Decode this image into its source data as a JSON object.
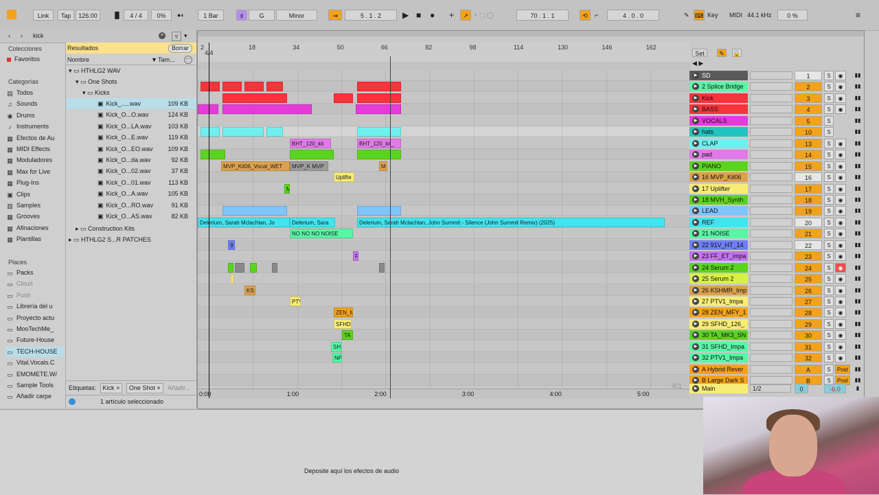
{
  "topbar": {
    "link": "Link",
    "tap": "Tap",
    "tempo": "126.00",
    "signature": "4 / 4",
    "cpu": "0%",
    "quantize": "1 Bar",
    "key": "G",
    "scale": "Minor",
    "position": "5 .  1 .  2",
    "loop_start": "70 .  1 .  1",
    "loop_length": "4 .  0 .  0",
    "key_label": "Key",
    "midi_label": "MIDI",
    "sample_rate": "44.1 kHz",
    "cpu_load": "0 %"
  },
  "browser": {
    "search_value": "kick",
    "colecciones_label": "Colecciones",
    "favoritos": "Favoritos",
    "results_label": "Resultados",
    "clear_button": "Borrar",
    "categorias_label": "Categorías",
    "categories": [
      "Todos",
      "Sounds",
      "Drums",
      "Instruments",
      "Efectos de Au",
      "MIDI Effects",
      "Moduladores",
      "Max for Live",
      "Plug-Ins",
      "Clips",
      "Samples",
      "Grooves",
      "Afinaciones",
      "Plantillas"
    ],
    "places_label": "Places",
    "places": [
      "Packs",
      "Cloud",
      "Push",
      "Librería del u",
      "Proyecto actu",
      "MooTechMe_",
      "Future-House",
      "TECH-HOUSE",
      "Vital.Vocals.C",
      "EMOMETE.W/",
      "Sample Tools",
      "Añadir carpe"
    ],
    "col_name": "Nombre",
    "col_size": "Tam...",
    "tree": {
      "root": "HTHLG2 WAV",
      "one_shots": "One Shots",
      "kicks": "Kicks",
      "construction_kits": "Construction Kits",
      "patches": "HTHLG2 S...R PATCHES"
    },
    "files": [
      {
        "name": "Kick_.....wav",
        "size": "109 KB"
      },
      {
        "name": "Kick_O...O.wav",
        "size": "124 KB"
      },
      {
        "name": "Kick_O...LA.wav",
        "size": "103 KB"
      },
      {
        "name": "Kick_O...E.wav",
        "size": "119 KB"
      },
      {
        "name": "Kick_O...EO.wav",
        "size": "109 KB"
      },
      {
        "name": "Kick_O...da.wav",
        "size": "92 KB"
      },
      {
        "name": "Kick_O...02.wav",
        "size": "37 KB"
      },
      {
        "name": "Kick_O...01.wav",
        "size": "113 KB"
      },
      {
        "name": "Kick_O...A.wav",
        "size": "105 KB"
      },
      {
        "name": "Kick_O...RO.wav",
        "size": "91 KB"
      },
      {
        "name": "Kick_O...AS.wav",
        "size": "82 KB"
      }
    ],
    "tags_label": "Etiquetas:",
    "tag1": "Kick",
    "tag2": "One Shot",
    "add_tag": "Añadir...",
    "status": "1 artículo seleccionado"
  },
  "arrangement": {
    "start_marker": "4/4",
    "bars": [
      "2",
      "18",
      "34",
      "50",
      "66",
      "82",
      "98",
      "114",
      "130",
      "146",
      "162"
    ],
    "times": [
      "0:00",
      "1:00",
      "2:00",
      "3:00",
      "4:00",
      "5:00"
    ],
    "zoom_label": "4/1",
    "set_label": "Set"
  },
  "clips": [
    {
      "lane": 1,
      "label": "",
      "color": "#f7333c",
      "start": 4,
      "width": 28
    },
    {
      "lane": 1,
      "label": "",
      "color": "#f7333c",
      "start": 36,
      "width": 28
    },
    {
      "lane": 1,
      "label": "",
      "color": "#f7333c",
      "start": 68,
      "width": 28
    },
    {
      "lane": 1,
      "label": "",
      "color": "#f7333c",
      "start": 100,
      "width": 24
    },
    {
      "lane": 1,
      "label": "",
      "color": "#f7333c",
      "start": 232,
      "width": 64
    },
    {
      "lane": 2,
      "label": "",
      "color": "#f7333c",
      "start": 36,
      "width": 94
    },
    {
      "lane": 2,
      "label": "",
      "color": "#f7333c",
      "start": 198,
      "width": 28
    },
    {
      "lane": 2,
      "label": "",
      "color": "#f7333c",
      "start": 232,
      "width": 64
    },
    {
      "lane": 3,
      "label": "",
      "color": "#e53bd9",
      "start": 0,
      "width": 30
    },
    {
      "lane": 3,
      "label": "",
      "color": "#e53bd9",
      "start": 36,
      "width": 130
    },
    {
      "lane": 3,
      "label": "",
      "color": "#e53bd9",
      "start": 230,
      "width": 66
    },
    {
      "lane": 5,
      "label": "",
      "color": "#6ff0ee",
      "start": 4,
      "width": 28
    },
    {
      "lane": 5,
      "label": "",
      "color": "#6ff0ee",
      "start": 36,
      "width": 60
    },
    {
      "lane": 5,
      "label": "",
      "color": "#6ff0ee",
      "start": 100,
      "width": 24
    },
    {
      "lane": 5,
      "label": "",
      "color": "#6ff0ee",
      "start": 232,
      "width": 64
    },
    {
      "lane": 6,
      "label": "BHT_120_kit",
      "color": "#e17ae8",
      "start": 134,
      "width": 60
    },
    {
      "lane": 6,
      "label": "BHT_120_kit_",
      "color": "#e17ae8",
      "start": 232,
      "width": 64
    },
    {
      "lane": 7,
      "label": "",
      "color": "#5bd41f",
      "start": 4,
      "width": 36
    },
    {
      "lane": 7,
      "label": "",
      "color": "#5bd41f",
      "start": 134,
      "width": 64
    },
    {
      "lane": 7,
      "label": "",
      "color": "#5bd41f",
      "start": 232,
      "width": 64
    },
    {
      "lane": 8,
      "label": "MVP_Kit06_Vocal_WET",
      "color": "#dca14c",
      "start": 34,
      "width": 100
    },
    {
      "lane": 8,
      "label": "MVP_K MVP",
      "color": "#9c9c9c",
      "start": 134,
      "width": 56
    },
    {
      "lane": 8,
      "label": "M",
      "color": "#dca14c",
      "start": 264,
      "width": 12
    },
    {
      "lane": 9,
      "label": "Uplifte",
      "color": "#f7ec76",
      "start": 198,
      "width": 30
    },
    {
      "lane": 10,
      "label": "M",
      "color": "#5bd41f",
      "start": 126,
      "width": 8
    },
    {
      "lane": 12,
      "label": "",
      "color": "#80c4ff",
      "start": 36,
      "width": 94
    },
    {
      "lane": 12,
      "label": "",
      "color": "#80c4ff",
      "start": 232,
      "width": 64
    },
    {
      "lane": 13,
      "label": "Delerium, Sarah Mclachlan, Jo",
      "color": "#3fe5f0",
      "start": 0,
      "width": 134
    },
    {
      "lane": 13,
      "label": "Delerium, Sara",
      "color": "#3fe5f0",
      "start": 134,
      "width": 66
    },
    {
      "lane": 13,
      "label": "Delerium, Sarah Mclachlan, John Summit - Silence (John Summit Remix) (2025)",
      "color": "#3fe5f0",
      "start": 232,
      "width": 448
    },
    {
      "lane": 14,
      "label": "NO NO NO NOISE",
      "color": "#5af5a6",
      "start": 134,
      "width": 92
    },
    {
      "lane": 15,
      "label": "9",
      "color": "#6f7ef5",
      "start": 44,
      "width": 10
    },
    {
      "lane": 16,
      "label": "F",
      "color": "#c373ec",
      "start": 226,
      "width": 8
    },
    {
      "lane": 17,
      "label": "",
      "color": "#5bd41f",
      "start": 44,
      "width": 8
    },
    {
      "lane": 17,
      "label": "",
      "color": "#8a8a8a",
      "start": 54,
      "width": 14
    },
    {
      "lane": 17,
      "label": "",
      "color": "#5bd41f",
      "start": 76,
      "width": 10
    },
    {
      "lane": 17,
      "label": "",
      "color": "#8a8a8a",
      "start": 108,
      "width": 8
    },
    {
      "lane": 17,
      "label": "",
      "color": "#8a8a8a",
      "start": 264,
      "width": 8
    },
    {
      "lane": 18,
      "label": "",
      "color": "#f7ec76",
      "start": 48,
      "width": 4
    },
    {
      "lane": 19,
      "label": "KS",
      "color": "#dca14c",
      "start": 68,
      "width": 16
    },
    {
      "lane": 20,
      "label": "PTV",
      "color": "#f7ec76",
      "start": 134,
      "width": 16
    },
    {
      "lane": 21,
      "label": "ZEN_M",
      "color": "#f2a21b",
      "start": 198,
      "width": 28
    },
    {
      "lane": 22,
      "label": "SFHD",
      "color": "#f7ec76",
      "start": 198,
      "width": 26
    },
    {
      "lane": 23,
      "label": "TA",
      "color": "#5bd41f",
      "start": 210,
      "width": 16
    },
    {
      "lane": 24,
      "label": "SH",
      "color": "#5af5a6",
      "start": 194,
      "width": 16
    },
    {
      "lane": 25,
      "label": "NP",
      "color": "#5af5a6",
      "start": 196,
      "width": 14
    }
  ],
  "tracks": [
    {
      "name": "SD",
      "color": "#5a5a5a",
      "text": "#ffffff",
      "num": "1",
      "yellow": false,
      "rec": "rec"
    },
    {
      "name": "2 Splice Bridge",
      "color": "#5af5a6",
      "text": "#111111",
      "num": "2",
      "yellow": true,
      "rec": "rec"
    },
    {
      "name": "Kick",
      "color": "#f7333c",
      "text": "#111111",
      "num": "3",
      "yellow": true,
      "rec": "rec"
    },
    {
      "name": "BASS",
      "color": "#f7333c",
      "text": "#111111",
      "num": "4",
      "yellow": true,
      "rec": "rec"
    },
    {
      "name": "VOCALS",
      "color": "#e53bd9",
      "text": "#111111",
      "num": "5",
      "yellow": true,
      "rec": ""
    },
    {
      "name": "hats",
      "color": "#21c4c0",
      "text": "#111111",
      "num": "10",
      "yellow": true,
      "rec": ""
    },
    {
      "name": "CLAP",
      "color": "#6ff0ee",
      "text": "#111111",
      "num": "13",
      "yellow": true,
      "rec": "rec"
    },
    {
      "name": "pad",
      "color": "#e17ae8",
      "text": "#111111",
      "num": "14",
      "yellow": true,
      "rec": "rec"
    },
    {
      "name": "PIANO",
      "color": "#5bd41f",
      "text": "#111111",
      "num": "15",
      "yellow": true,
      "rec": "rec"
    },
    {
      "name": "16 MVP_Kit06",
      "color": "#dca14c",
      "text": "#111111",
      "num": "16",
      "yellow": false,
      "rec": "rec"
    },
    {
      "name": "17 Uplifter",
      "color": "#f7ec76",
      "text": "#111111",
      "num": "17",
      "yellow": true,
      "rec": "rec"
    },
    {
      "name": "18 MVH_Synth",
      "color": "#5bd41f",
      "text": "#111111",
      "num": "18",
      "yellow": true,
      "rec": "rec"
    },
    {
      "name": "LEAD",
      "color": "#80c4ff",
      "text": "#111111",
      "num": "19",
      "yellow": true,
      "rec": "rec"
    },
    {
      "name": "REF",
      "color": "#3fe5f0",
      "text": "#111111",
      "num": "20",
      "yellow": false,
      "rec": "rec"
    },
    {
      "name": "21 NOISE",
      "color": "#5af5a6",
      "text": "#111111",
      "num": "21",
      "yellow": true,
      "rec": "rec"
    },
    {
      "name": "22 91V_HT_14",
      "color": "#6f7ef5",
      "text": "#111111",
      "num": "22",
      "yellow": false,
      "rec": "rec"
    },
    {
      "name": "23 FF_ET_impa",
      "color": "#c373ec",
      "text": "#111111",
      "num": "23",
      "yellow": true,
      "rec": "rec"
    },
    {
      "name": "24 Serum 2",
      "color": "#5bd41f",
      "text": "#111111",
      "num": "24",
      "yellow": true,
      "rec": "red"
    },
    {
      "name": "25 Serum 2",
      "color": "#d7f04a",
      "text": "#111111",
      "num": "25",
      "yellow": true,
      "rec": "rec"
    },
    {
      "name": "26 KSHMR_Imp",
      "color": "#dca14c",
      "text": "#111111",
      "num": "26",
      "yellow": true,
      "rec": "rec"
    },
    {
      "name": "27 PTV1_Impa",
      "color": "#f7ec76",
      "text": "#111111",
      "num": "27",
      "yellow": true,
      "rec": "rec"
    },
    {
      "name": "28 ZEN_MFY_1",
      "color": "#f2a21b",
      "text": "#111111",
      "num": "28",
      "yellow": true,
      "rec": "rec"
    },
    {
      "name": "29 SFHD_126_",
      "color": "#f7ec76",
      "text": "#111111",
      "num": "29",
      "yellow": true,
      "rec": "rec"
    },
    {
      "name": "30 TA_MK3_SN",
      "color": "#5bd41f",
      "text": "#111111",
      "num": "30",
      "yellow": true,
      "rec": "rec"
    },
    {
      "name": "31 SFHD_Impa",
      "color": "#5af5a6",
      "text": "#111111",
      "num": "31",
      "yellow": true,
      "rec": "rec"
    },
    {
      "name": "32 PTV1_Impa",
      "color": "#5af5a6",
      "text": "#111111",
      "num": "32",
      "yellow": true,
      "rec": "rec"
    },
    {
      "name": "A Hybrid Rever",
      "color": "#f2a21b",
      "text": "#111111",
      "num": "A",
      "yellow": true,
      "rec": "post"
    },
    {
      "name": "B Large Dark S",
      "color": "#f2a21b",
      "text": "#111111",
      "num": "B",
      "yellow": true,
      "rec": "post"
    }
  ],
  "main_track": {
    "name": "Main",
    "routing": "1/2",
    "num": "0",
    "vol": "-6.0"
  },
  "bottom": {
    "drop_hint": "Deposite aquí los efectos de audio"
  }
}
